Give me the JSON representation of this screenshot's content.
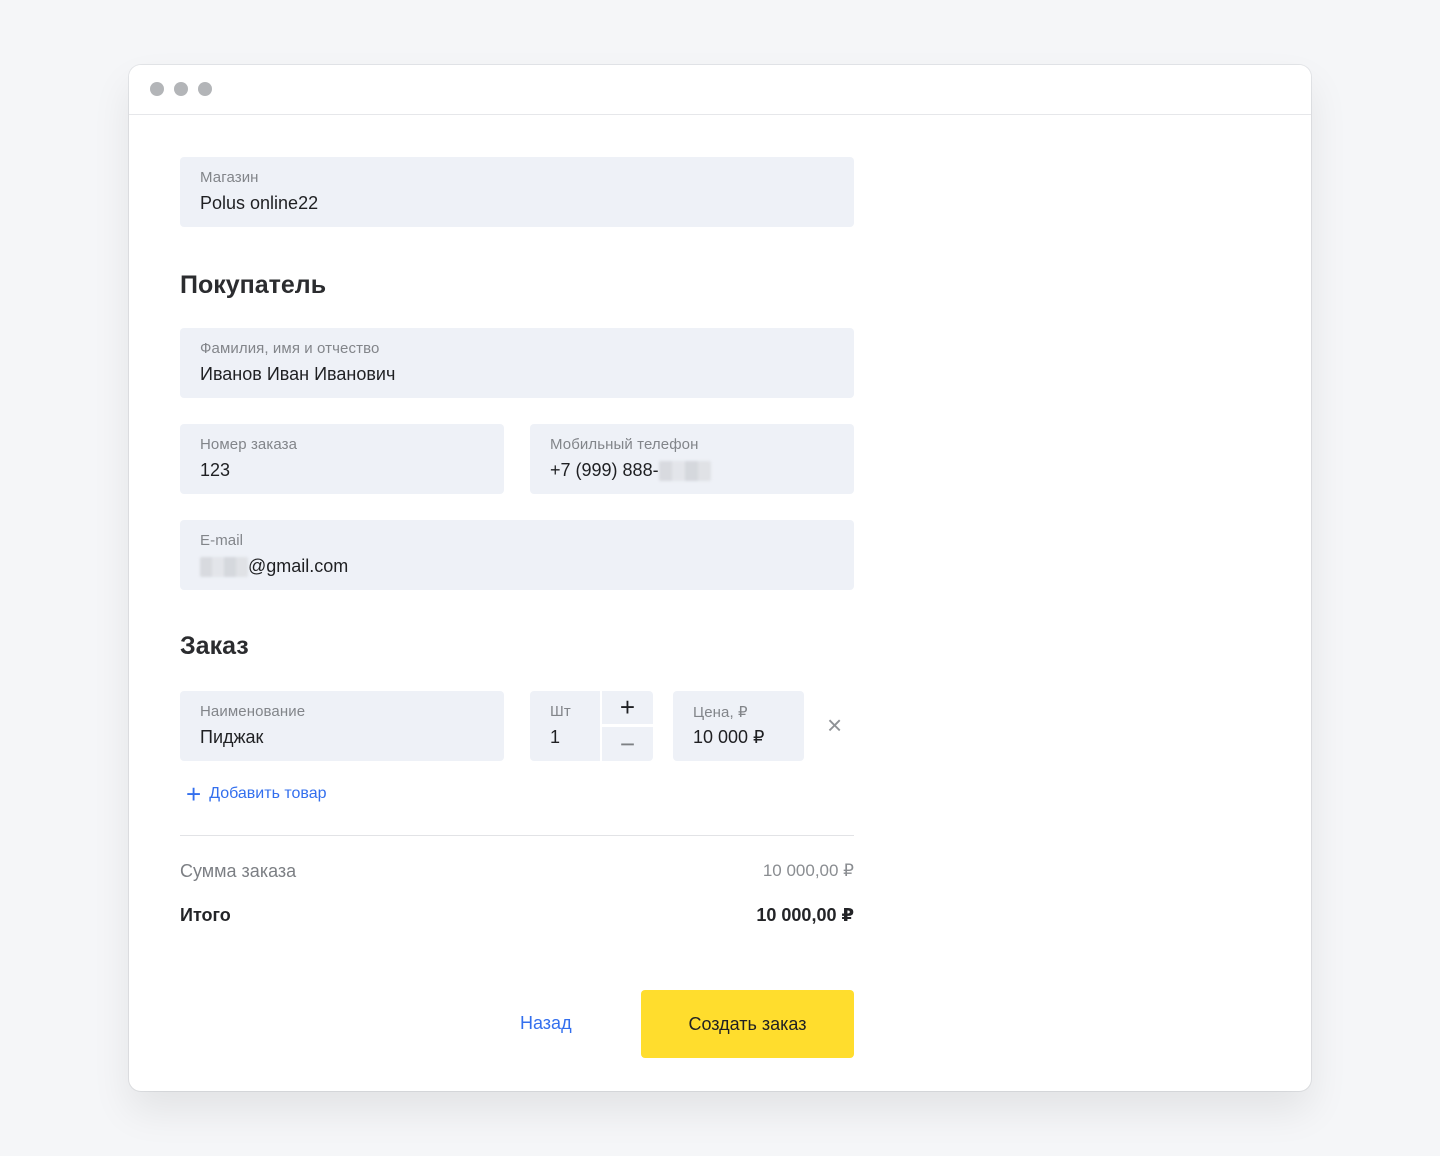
{
  "store": {
    "label": "Магазин",
    "value": "Polus online22"
  },
  "buyer": {
    "heading": "Покупатель",
    "full_name": {
      "label": "Фамилия, имя и отчество",
      "value": "Иванов Иван Иванович"
    },
    "order_number": {
      "label": "Номер заказа",
      "value": "123"
    },
    "phone": {
      "label": "Мобильный телефон",
      "value": "+7 (999) 888-"
    },
    "email": {
      "label": "E-mail",
      "value": "@gmail.com"
    }
  },
  "order": {
    "heading": "Заказ",
    "item": {
      "name_label": "Наименование",
      "name_value": "Пиджак",
      "qty_label": "Шт",
      "qty_value": "1",
      "plus": "+",
      "minus": "−",
      "price_label": "Цена, ₽",
      "price_value": "10 000 ₽",
      "remove": "×"
    },
    "add_item": {
      "icon": "+",
      "label": "Добавить товар"
    }
  },
  "summary": {
    "subtotal_label": "Сумма заказа",
    "subtotal_value": "10 000,00 ₽",
    "total_label": "Итого",
    "total_value": "10 000,00 ₽"
  },
  "actions": {
    "back": "Назад",
    "create": "Создать заказ"
  },
  "colors": {
    "accent": "#ffdd2d",
    "link": "#336fee",
    "field_bg": "#eef1f7"
  }
}
